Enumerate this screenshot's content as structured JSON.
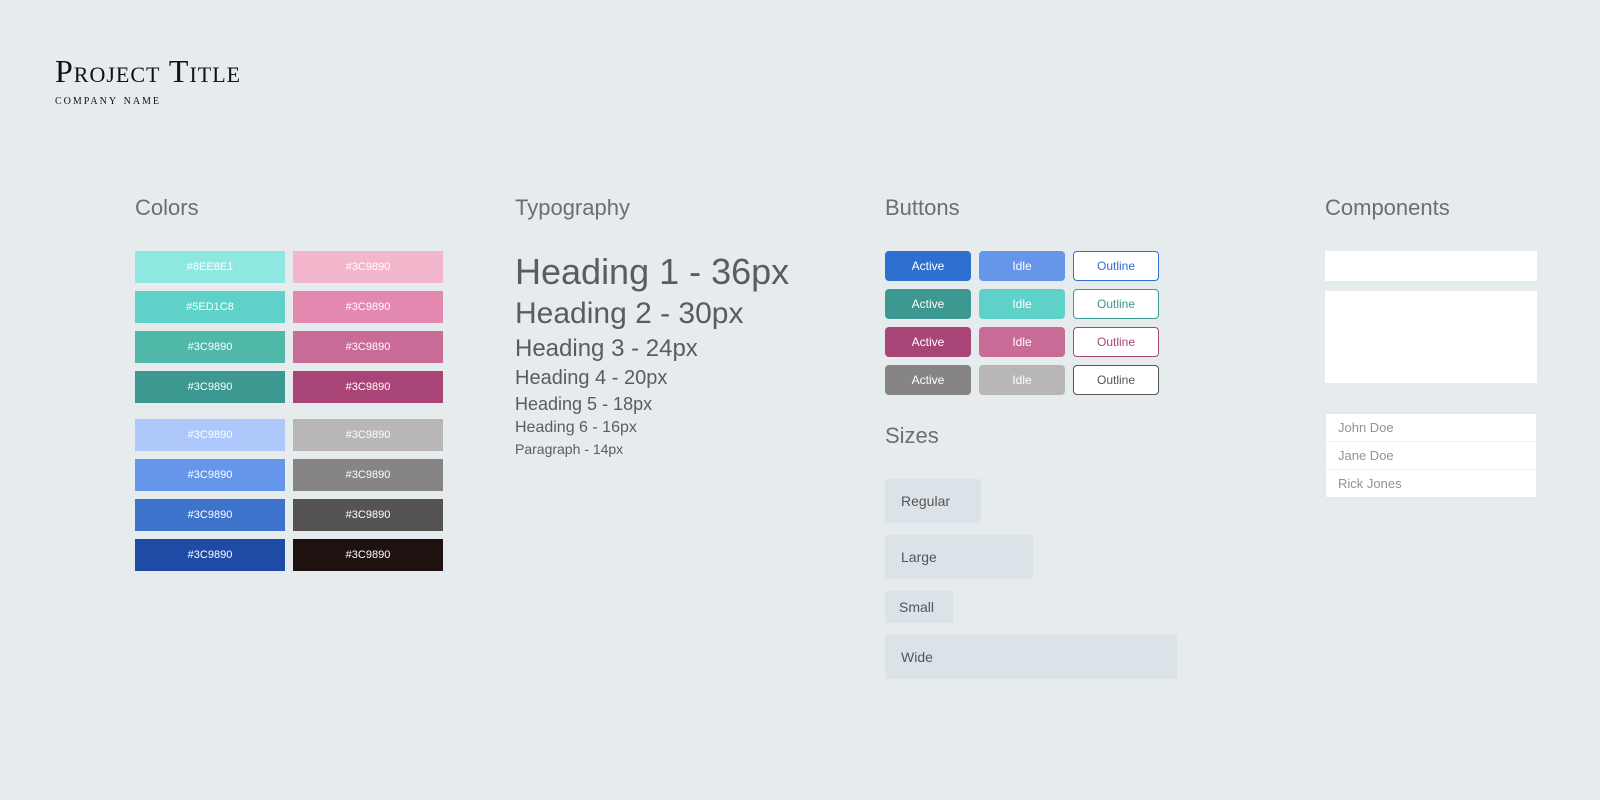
{
  "header": {
    "project_title": "Project Title",
    "company_name": "company name"
  },
  "sections": {
    "colors": "Colors",
    "typography": "Typography",
    "buttons": "Buttons",
    "sizes": "Sizes",
    "components": "Components"
  },
  "colors": {
    "group1_left": [
      {
        "label": "#8EE8E1",
        "hex": "#8EE8E1"
      },
      {
        "label": "#5ED1C8",
        "hex": "#5ED1C8"
      },
      {
        "label": "#3C9890",
        "hex": "#4FB8A9"
      },
      {
        "label": "#3C9890",
        "hex": "#3C9890"
      }
    ],
    "group1_right": [
      {
        "label": "#3C9890",
        "hex": "#F3B6CD"
      },
      {
        "label": "#3C9890",
        "hex": "#E389B0"
      },
      {
        "label": "#3C9890",
        "hex": "#C96B97"
      },
      {
        "label": "#3C9890",
        "hex": "#A94477"
      }
    ],
    "group2_left": [
      {
        "label": "#3C9890",
        "hex": "#AEC8FB"
      },
      {
        "label": "#3C9890",
        "hex": "#6596EA"
      },
      {
        "label": "#3C9890",
        "hex": "#3D73CB"
      },
      {
        "label": "#3C9890",
        "hex": "#1E4CA4"
      }
    ],
    "group2_right": [
      {
        "label": "#3C9890",
        "hex": "#B8B6B6"
      },
      {
        "label": "#3C9890",
        "hex": "#868484"
      },
      {
        "label": "#3C9890",
        "hex": "#555353"
      },
      {
        "label": "#3C9890",
        "hex": "#1E1210"
      }
    ]
  },
  "typography": {
    "h1": "Heading 1 - 36px",
    "h2": "Heading 2 - 30px",
    "h3": "Heading 3 - 24px",
    "h4": "Heading 4 - 20px",
    "h5": "Heading 5 - 18px",
    "h6": "Heading 6 - 16px",
    "p": "Paragraph - 14px"
  },
  "buttons": {
    "labels": {
      "active": "Active",
      "idle": "Idle",
      "outline": "Outline"
    },
    "rows": [
      {
        "active": "#2f6fcf",
        "idle": "#6596ea",
        "outline": "#2f6fcf"
      },
      {
        "active": "#3C9890",
        "idle": "#5ED1C8",
        "outline": "#3C9890"
      },
      {
        "active": "#A94477",
        "idle": "#C96B97",
        "outline": "#A94477"
      },
      {
        "active": "#868484",
        "idle": "#B8B6B6",
        "outline": "#555353"
      }
    ]
  },
  "sizes": {
    "regular": "Regular",
    "large": "Large",
    "small": "Small",
    "wide": "Wide"
  },
  "components": {
    "list": [
      "John Doe",
      "Jane Doe",
      "Rick Jones"
    ]
  }
}
